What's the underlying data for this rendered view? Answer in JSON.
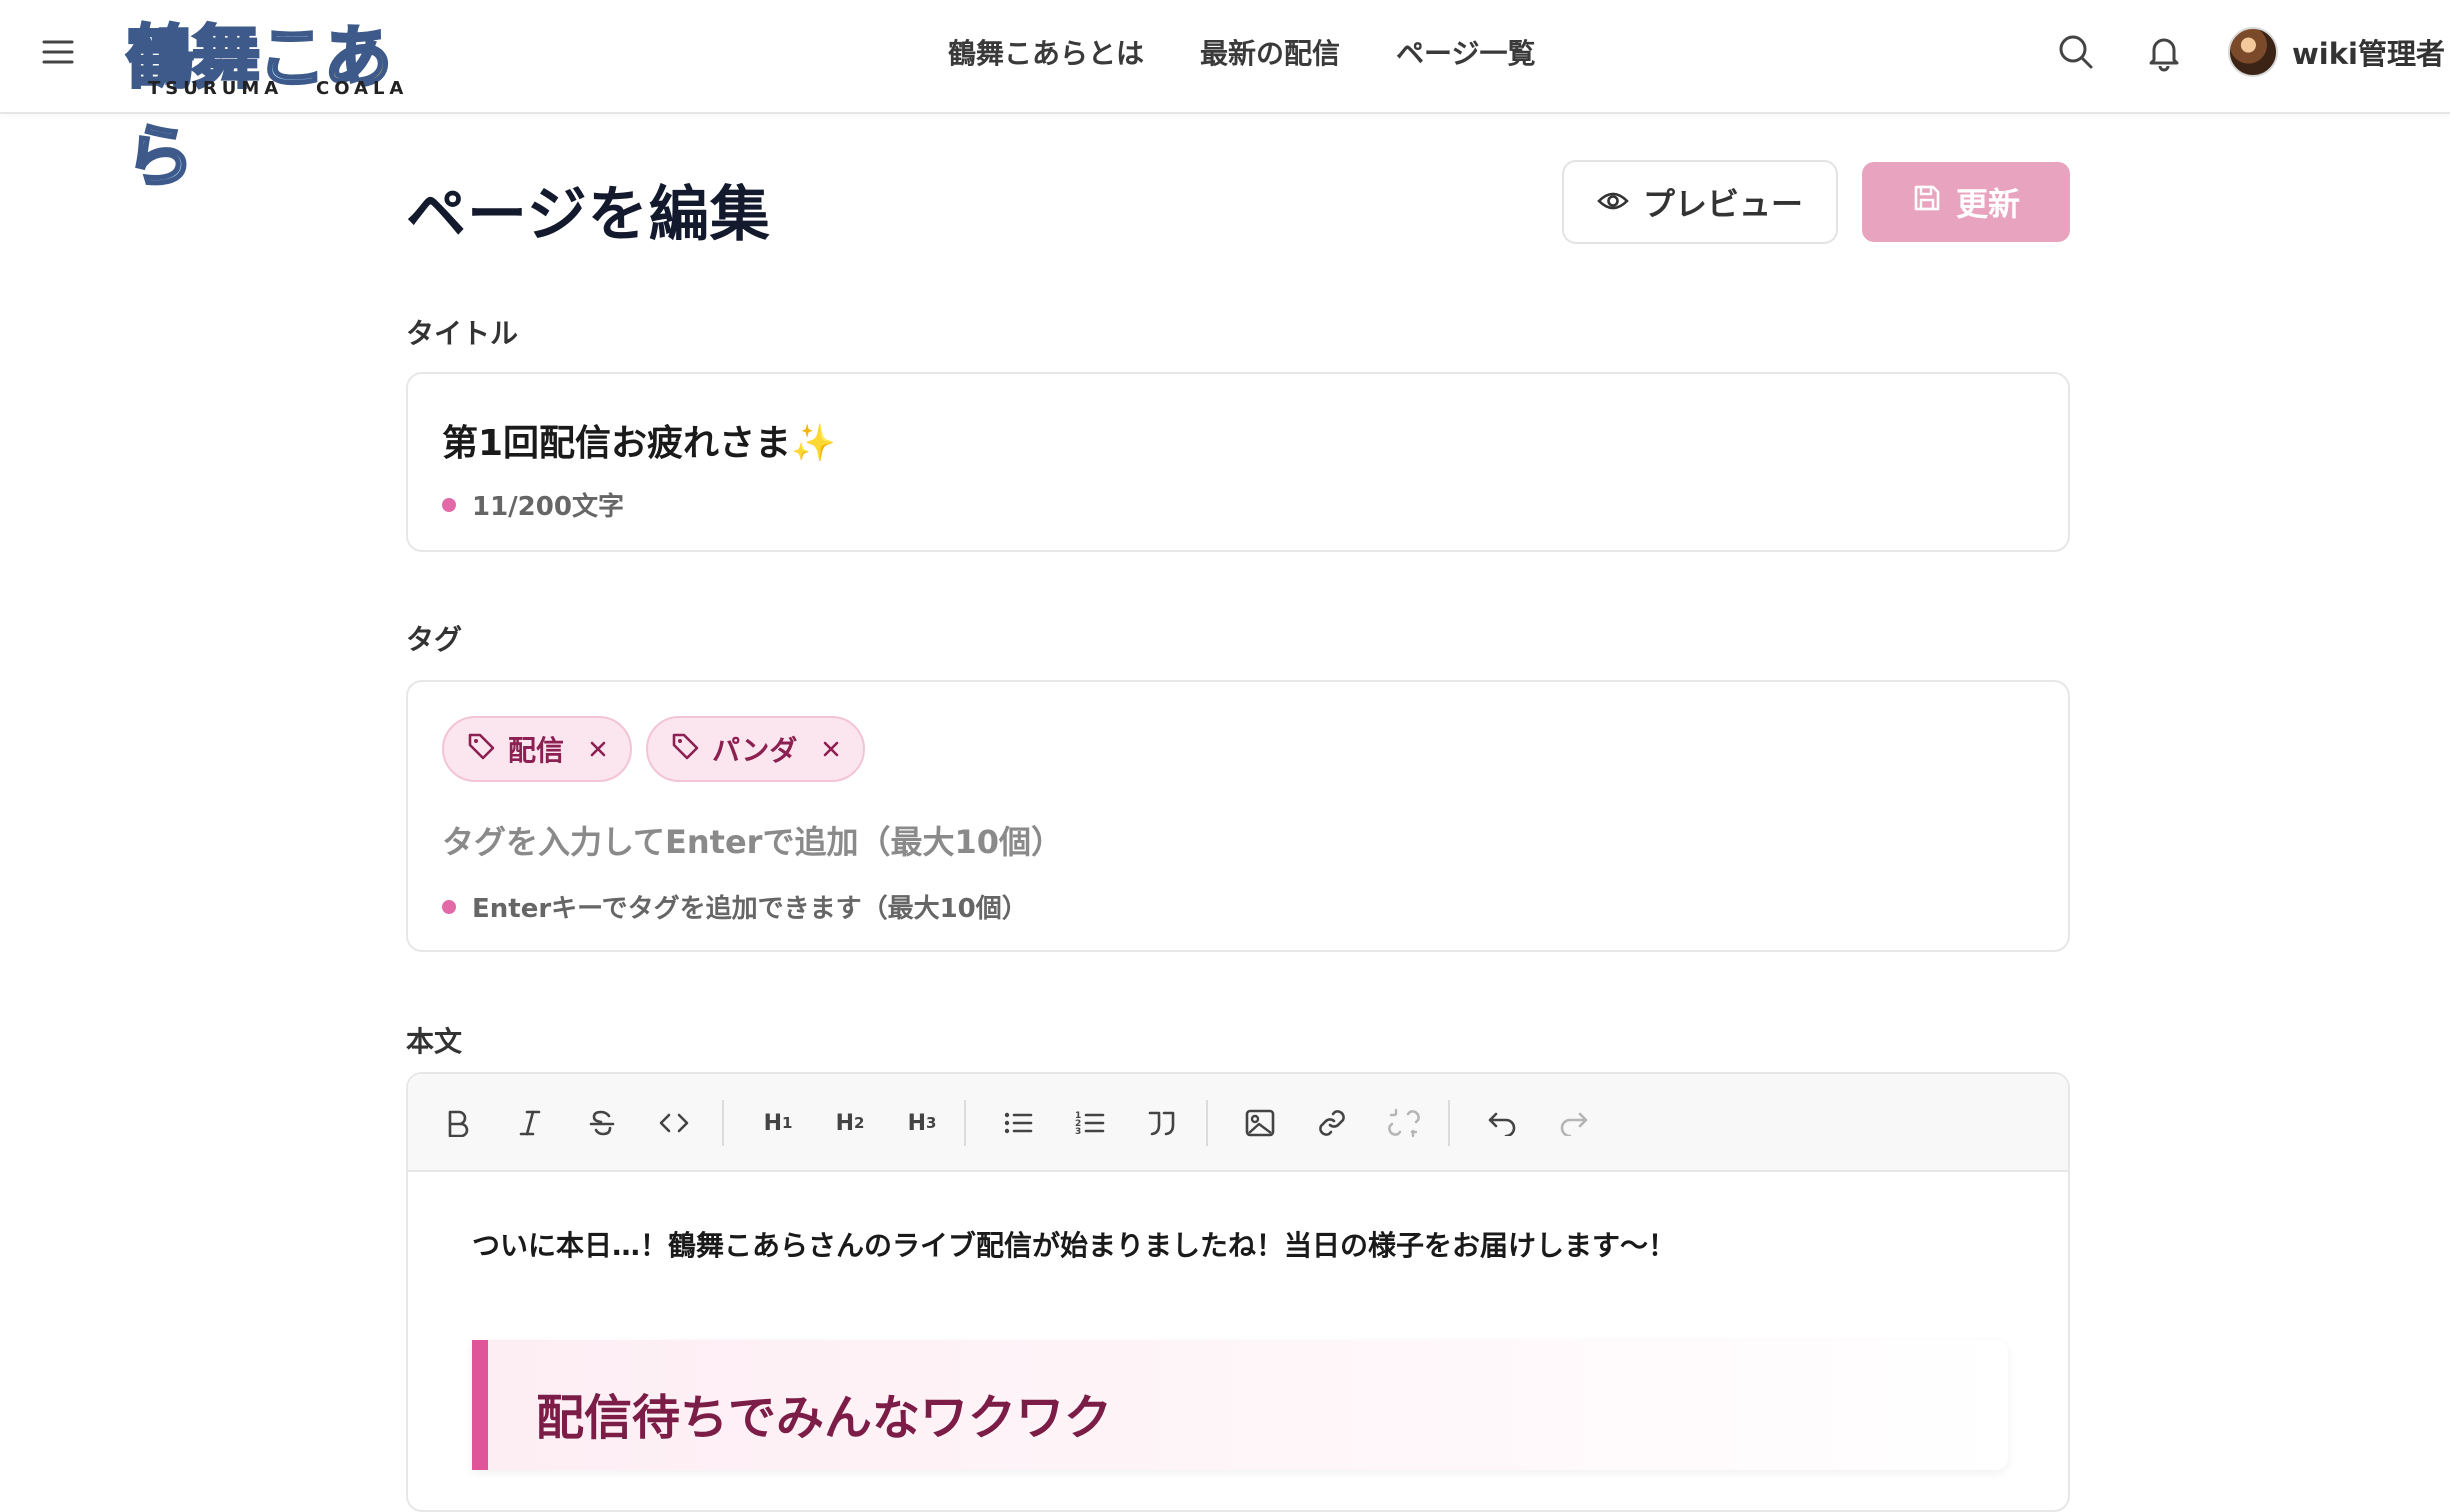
{
  "header": {
    "logo_text": [
      "鶴",
      "舞",
      "こ",
      "あ",
      "ら"
    ],
    "logo_sub_left": "TSURUMA",
    "logo_sub_right": "COALA",
    "nav": [
      "鶴舞こあらとは",
      "最新の配信",
      "ページ一覧"
    ],
    "user_name": "wiki管理者"
  },
  "page": {
    "title": "ページを編集",
    "preview_label": "プレビュー",
    "update_label": "更新"
  },
  "title_section": {
    "label": "タイトル",
    "value": "第1回配信お疲れさま✨",
    "counter": "11/200文字"
  },
  "tag_section": {
    "label": "タグ",
    "tags": [
      "配信",
      "パンダ"
    ],
    "placeholder": "タグを入力してEnterで追加（最大10個）",
    "hint": "Enterキーでタグを追加できます（最大10個）"
  },
  "body_section": {
    "label": "本文",
    "toolbar": [
      "bold",
      "italic",
      "strikethrough",
      "code",
      "H1",
      "H2",
      "H3",
      "bullet-list",
      "ordered-list",
      "quote",
      "image",
      "link",
      "unlink",
      "undo",
      "redo"
    ],
    "paragraph": "ついに本日…！鶴舞こあらさんのライブ配信が始まりましたね！当日の様子をお届けします〜！",
    "callout_heading": "配信待ちでみんなワクワク"
  },
  "colors": {
    "accent": "#e0559a",
    "update_button": "#e8a4bf",
    "tag_bg": "#fbe5ee",
    "tag_text": "#8c2052"
  }
}
